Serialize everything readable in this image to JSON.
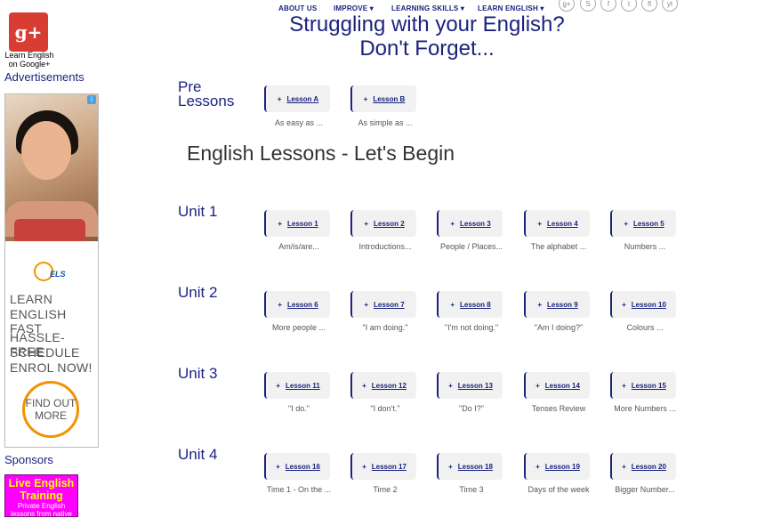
{
  "sidebar": {
    "gplus_glyph": "g+",
    "gplus_caption_1": "Learn English",
    "gplus_caption_2": "on Google+",
    "ads_heading": "Advertisements",
    "ad": {
      "info_glyph": "i",
      "logo_text": "ELS",
      "line1": "LEARN",
      "line2": "ENGLISH FAST",
      "line3": "HASSLE-FREE",
      "line4": "SCHEDULE",
      "line5": "ENROL NOW!",
      "cta_1": "FIND OUT",
      "cta_2": "MORE"
    },
    "sponsors_heading": "Sponsors",
    "sponsor": {
      "title_1": "Live English",
      "title_2": "Training",
      "sub": "Private English lessons from native"
    }
  },
  "nav": {
    "items": [
      "ABOUT US",
      "IMPROVE",
      "LEARNING SKILLS",
      "LEARN ENGLISH"
    ],
    "social": [
      "g+",
      "S",
      "f",
      "t",
      "fl",
      "yt"
    ]
  },
  "headline_1": "Struggling with your English?",
  "headline_2": "Don't Forget...",
  "pre": {
    "label_1": "Pre",
    "label_2": "Lessons",
    "lessons": [
      {
        "label": "Lesson A",
        "desc": "As easy as ..."
      },
      {
        "label": "Lesson B",
        "desc": "As simple as ..."
      }
    ]
  },
  "section_title": "English Lessons - Let's Begin",
  "units": [
    {
      "label": "Unit 1",
      "lessons": [
        {
          "label": "Lesson 1",
          "desc": "Am/is/are..."
        },
        {
          "label": "Lesson 2",
          "desc": "Introductions..."
        },
        {
          "label": "Lesson 3",
          "desc": "People / Places..."
        },
        {
          "label": "Lesson 4",
          "desc": "The alphabet ..."
        },
        {
          "label": "Lesson 5",
          "desc": "Numbers ..."
        }
      ]
    },
    {
      "label": "Unit 2",
      "lessons": [
        {
          "label": "Lesson 6",
          "desc": "More people ..."
        },
        {
          "label": "Lesson 7",
          "desc": "\"I am doing.\""
        },
        {
          "label": "Lesson 8",
          "desc": "\"I'm not doing.\""
        },
        {
          "label": "Lesson 9",
          "desc": "\"Am I doing?\""
        },
        {
          "label": "Lesson 10",
          "desc": "Colours ..."
        }
      ]
    },
    {
      "label": "Unit 3",
      "lessons": [
        {
          "label": "Lesson 11",
          "desc": "\"I do.\""
        },
        {
          "label": "Lesson 12",
          "desc": "\"I don't.\""
        },
        {
          "label": "Lesson 13",
          "desc": "\"Do I?\""
        },
        {
          "label": "Lesson 14",
          "desc": "Tenses Review"
        },
        {
          "label": "Lesson 15",
          "desc": "More Numbers ..."
        }
      ]
    },
    {
      "label": "Unit 4",
      "lessons": [
        {
          "label": "Lesson 16",
          "desc": "Time 1 - On the ..."
        },
        {
          "label": "Lesson 17",
          "desc": "Time 2"
        },
        {
          "label": "Lesson 18",
          "desc": "Time 3"
        },
        {
          "label": "Lesson 19",
          "desc": "Days of the week"
        },
        {
          "label": "Lesson 20",
          "desc": "Bigger Number..."
        }
      ]
    }
  ]
}
